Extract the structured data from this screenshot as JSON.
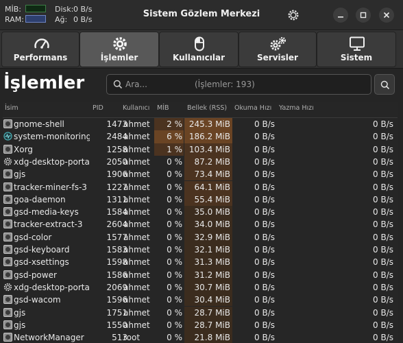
{
  "app_title": "Sistem Gözlem Merkezi",
  "mini_stats": {
    "cpu_label": "MİB:",
    "ram_label": "RAM:",
    "disk_label": "Disk:",
    "disk_value": "0 B/s",
    "net_label": "Ağ:",
    "net_value": "0 B/s"
  },
  "tabs": [
    {
      "label": "Performans",
      "icon": "gauge-icon",
      "active": false
    },
    {
      "label": "İşlemler",
      "icon": "gear-icon",
      "active": true
    },
    {
      "label": "Kullanıcılar",
      "icon": "mouse-icon",
      "active": false
    },
    {
      "label": "Servisler",
      "icon": "gears-icon",
      "active": false
    },
    {
      "label": "Sistem",
      "icon": "monitor-icon",
      "active": false
    }
  ],
  "page_title": "İşlemler",
  "search": {
    "placeholder": "Ara...",
    "count_text": "(İşlemler: 193)"
  },
  "columns": {
    "name": "İsim",
    "pid": "PID",
    "user": "Kullanıcı",
    "cpu": "MİB",
    "memory": "Bellek (RSS)",
    "read": "Okuma Hızı",
    "write": "Yazma Hızı"
  },
  "rows": [
    {
      "name": "gnome-shell",
      "pid": "1473",
      "user": "ahmet",
      "cpu": "2 %",
      "memory": "245.3 MiB",
      "read": "0 B/s",
      "write": "0 B/s",
      "icon": "generic",
      "cpu_level": 2,
      "mem_level": 3
    },
    {
      "name": "system-monitoring-c",
      "pid": "2484",
      "user": "ahmet",
      "cpu": "6 %",
      "memory": "186.2 MiB",
      "read": "0 B/s",
      "write": "0 B/s",
      "icon": "monitor",
      "cpu_level": 3,
      "mem_level": 3
    },
    {
      "name": "Xorg",
      "pid": "1258",
      "user": "ahmet",
      "cpu": "1 %",
      "memory": "103.4 MiB",
      "read": "0 B/s",
      "write": "0 B/s",
      "icon": "generic",
      "cpu_level": 2,
      "mem_level": 2
    },
    {
      "name": "xdg-desktop-portal-",
      "pid": "2050",
      "user": "ahmet",
      "cpu": "0 %",
      "memory": "87.2 MiB",
      "read": "0 B/s",
      "write": "0 B/s",
      "icon": "gear",
      "cpu_level": 0,
      "mem_level": 2
    },
    {
      "name": "gjs",
      "pid": "1906",
      "user": "ahmet",
      "cpu": "0 %",
      "memory": "73.4 MiB",
      "read": "0 B/s",
      "write": "0 B/s",
      "icon": "generic",
      "cpu_level": 0,
      "mem_level": 2
    },
    {
      "name": "tracker-miner-fs-3",
      "pid": "1227",
      "user": "ahmet",
      "cpu": "0 %",
      "memory": "64.1 MiB",
      "read": "0 B/s",
      "write": "0 B/s",
      "icon": "generic",
      "cpu_level": 0,
      "mem_level": 2
    },
    {
      "name": "goa-daemon",
      "pid": "1311",
      "user": "ahmet",
      "cpu": "0 %",
      "memory": "55.4 MiB",
      "read": "0 B/s",
      "write": "0 B/s",
      "icon": "generic",
      "cpu_level": 0,
      "mem_level": 2
    },
    {
      "name": "gsd-media-keys",
      "pid": "1584",
      "user": "ahmet",
      "cpu": "0 %",
      "memory": "35.0 MiB",
      "read": "0 B/s",
      "write": "0 B/s",
      "icon": "generic",
      "cpu_level": 0,
      "mem_level": 1
    },
    {
      "name": "tracker-extract-3",
      "pid": "2604",
      "user": "ahmet",
      "cpu": "0 %",
      "memory": "34.0 MiB",
      "read": "0 B/s",
      "write": "0 B/s",
      "icon": "generic",
      "cpu_level": 0,
      "mem_level": 1
    },
    {
      "name": "gsd-color",
      "pid": "1577",
      "user": "ahmet",
      "cpu": "0 %",
      "memory": "32.9 MiB",
      "read": "0 B/s",
      "write": "0 B/s",
      "icon": "generic",
      "cpu_level": 0,
      "mem_level": 1
    },
    {
      "name": "gsd-keyboard",
      "pid": "1583",
      "user": "ahmet",
      "cpu": "0 %",
      "memory": "32.1 MiB",
      "read": "0 B/s",
      "write": "0 B/s",
      "icon": "generic",
      "cpu_level": 0,
      "mem_level": 1
    },
    {
      "name": "gsd-xsettings",
      "pid": "1598",
      "user": "ahmet",
      "cpu": "0 %",
      "memory": "31.3 MiB",
      "read": "0 B/s",
      "write": "0 B/s",
      "icon": "generic",
      "cpu_level": 0,
      "mem_level": 1
    },
    {
      "name": "gsd-power",
      "pid": "1586",
      "user": "ahmet",
      "cpu": "0 %",
      "memory": "31.2 MiB",
      "read": "0 B/s",
      "write": "0 B/s",
      "icon": "generic",
      "cpu_level": 0,
      "mem_level": 1
    },
    {
      "name": "xdg-desktop-portal-",
      "pid": "2069",
      "user": "ahmet",
      "cpu": "0 %",
      "memory": "30.7 MiB",
      "read": "0 B/s",
      "write": "0 B/s",
      "icon": "gear",
      "cpu_level": 0,
      "mem_level": 1
    },
    {
      "name": "gsd-wacom",
      "pid": "1596",
      "user": "ahmet",
      "cpu": "0 %",
      "memory": "30.4 MiB",
      "read": "0 B/s",
      "write": "0 B/s",
      "icon": "generic",
      "cpu_level": 0,
      "mem_level": 1
    },
    {
      "name": "gjs",
      "pid": "1751",
      "user": "ahmet",
      "cpu": "0 %",
      "memory": "28.7 MiB",
      "read": "0 B/s",
      "write": "0 B/s",
      "icon": "generic",
      "cpu_level": 0,
      "mem_level": 1
    },
    {
      "name": "gjs",
      "pid": "1550",
      "user": "ahmet",
      "cpu": "0 %",
      "memory": "28.7 MiB",
      "read": "0 B/s",
      "write": "0 B/s",
      "icon": "generic",
      "cpu_level": 0,
      "mem_level": 1
    },
    {
      "name": "NetworkManager",
      "pid": "513",
      "user": "root",
      "cpu": "0 %",
      "memory": "21.8 MiB",
      "read": "0 B/s",
      "write": "0 B/s",
      "icon": "generic",
      "cpu_level": 0,
      "mem_level": 1
    }
  ],
  "colors": {
    "heat_1": "#3b2c1e",
    "heat_2": "#4b3320",
    "heat_3": "#6a4424",
    "accent": "#585858"
  }
}
